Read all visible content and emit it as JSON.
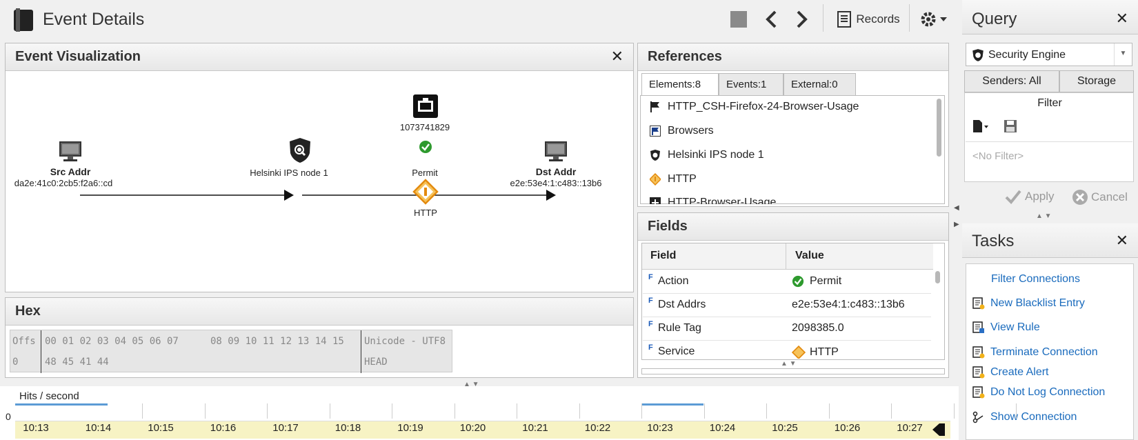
{
  "app": {
    "title": "Event Details"
  },
  "toolbar": {
    "records_label": "Records"
  },
  "visualization": {
    "title": "Event Visualization",
    "src": {
      "title": "Src Addr",
      "address": "da2e:41c0:2cb5:f2a6::cd"
    },
    "node": {
      "label": "Helsinki IPS node 1"
    },
    "rule_id": "1073741829",
    "action": "Permit",
    "service": "HTTP",
    "dst": {
      "title": "Dst Addr",
      "address": "e2e:53e4:1:c483::13b6"
    }
  },
  "hex": {
    "title": "Hex",
    "header_offset": "Offs",
    "header_bytes_1": "00 01 02 03 04 05 06 07",
    "header_bytes_2": "08 09 10 11 12 13 14 15",
    "header_unicode": "Unicode - UTF8",
    "row_offset": "0",
    "row_bytes": "48 45 41 44",
    "row_text": "HEAD"
  },
  "references": {
    "title": "References",
    "tabs": [
      {
        "label": "Elements:8"
      },
      {
        "label": "Events:1"
      },
      {
        "label": "External:0"
      }
    ],
    "items": [
      {
        "label": "HTTP_CSH-Firefox-24-Browser-Usage",
        "icon": "flag-icon"
      },
      {
        "label": "Browsers",
        "icon": "flag-group-icon"
      },
      {
        "label": "Helsinki IPS node 1",
        "icon": "shield-icon"
      },
      {
        "label": "HTTP",
        "icon": "service-icon"
      },
      {
        "label": "HTTP-Browser-Usage",
        "icon": "situation-icon"
      }
    ]
  },
  "fields": {
    "title": "Fields",
    "col_field": "Field",
    "col_value": "Value",
    "rows": [
      {
        "field": "Action",
        "value": "Permit"
      },
      {
        "field": "Dst Addrs",
        "value": "e2e:53e4:1:c483::13b6"
      },
      {
        "field": "Rule Tag",
        "value": "2098385.0"
      },
      {
        "field": "Service",
        "value": "HTTP"
      }
    ]
  },
  "query": {
    "title": "Query",
    "engine": "Security Engine",
    "tab_senders": "Senders: All",
    "tab_storage": "Storage",
    "filter_label": "Filter",
    "filter_placeholder": "<No Filter>",
    "apply_label": "Apply",
    "cancel_label": "Cancel"
  },
  "tasks": {
    "title": "Tasks",
    "items": [
      {
        "label": "Filter Connections",
        "icon": ""
      },
      {
        "label": "New Blacklist Entry",
        "icon": "blacklist-icon"
      },
      {
        "label": "View Rule",
        "icon": "rule-icon"
      },
      {
        "label": "Terminate Connection",
        "icon": "terminate-icon"
      },
      {
        "label": "Create Alert",
        "icon": "alert-icon"
      },
      {
        "label": "Do Not Log Connection",
        "icon": "nolog-icon"
      },
      {
        "label": "Show Connection",
        "icon": "connection-icon"
      }
    ]
  },
  "timeline": {
    "label": "Hits / second",
    "y_zero": "0",
    "ticks": [
      "10:13",
      "10:14",
      "10:15",
      "10:16",
      "10:17",
      "10:18",
      "10:19",
      "10:20",
      "10:21",
      "10:22",
      "10:23",
      "10:24",
      "10:25",
      "10:26",
      "10:27"
    ]
  },
  "colors": {
    "accent": "#1a6bbd",
    "timeline_bg": "#f7f3c4",
    "permit": "#2e9a2e",
    "service": "#f29b1a"
  }
}
